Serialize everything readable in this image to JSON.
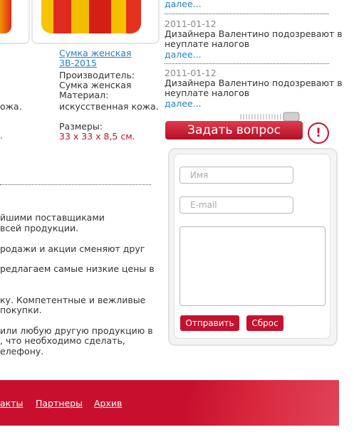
{
  "product_left": {
    "material_tail": "ожа.",
    "price_tail": "."
  },
  "product": {
    "name": "Сумка женская ЗВ-2015",
    "name_line1": "Сумка женская",
    "name_line2": "ЗВ-2015",
    "manufacturer_label": "Производитель:",
    "manufacturer_value": "Сумка женская",
    "material_label": "Материал:",
    "material_value": "искусственная кожа.",
    "sizes_label": "Размеры:",
    "sizes_value": "33 х 33 х 8,5 см."
  },
  "news": [
    {
      "more": "далее..."
    },
    {
      "date": "2011-01-12",
      "title_line1": "Дизайнера Валентино подозревают в",
      "title_line2": "неуплате налогов",
      "more": "далее..."
    },
    {
      "date": "2011-01-12",
      "title_line1": "Дизайнера Валентино подозревают в",
      "title_line2": "неуплате налогов",
      "more": "далее..."
    }
  ],
  "ask": {
    "button_label": "Задать вопрос",
    "exclaim": "!",
    "name_placeholder": "Имя",
    "email_placeholder": "E-mail",
    "submit_label": "Отправить",
    "reset_label": "Сброс"
  },
  "about_lines": [
    "йшими поставщиками",
    "всей продукции.",
    "родажи и акции сменяют друг",
    "редлагаем самые низкие цены в",
    "ку. Компетентные и вежливые",
    "покупки.",
    "или любую другую продукцию в",
    ", что необходимо сделать,",
    "елефону."
  ],
  "footer": {
    "links": [
      "акты",
      "Партнеры",
      "Архив"
    ]
  },
  "colors": {
    "accent": "#c4122e",
    "link": "#2a7fbf"
  }
}
